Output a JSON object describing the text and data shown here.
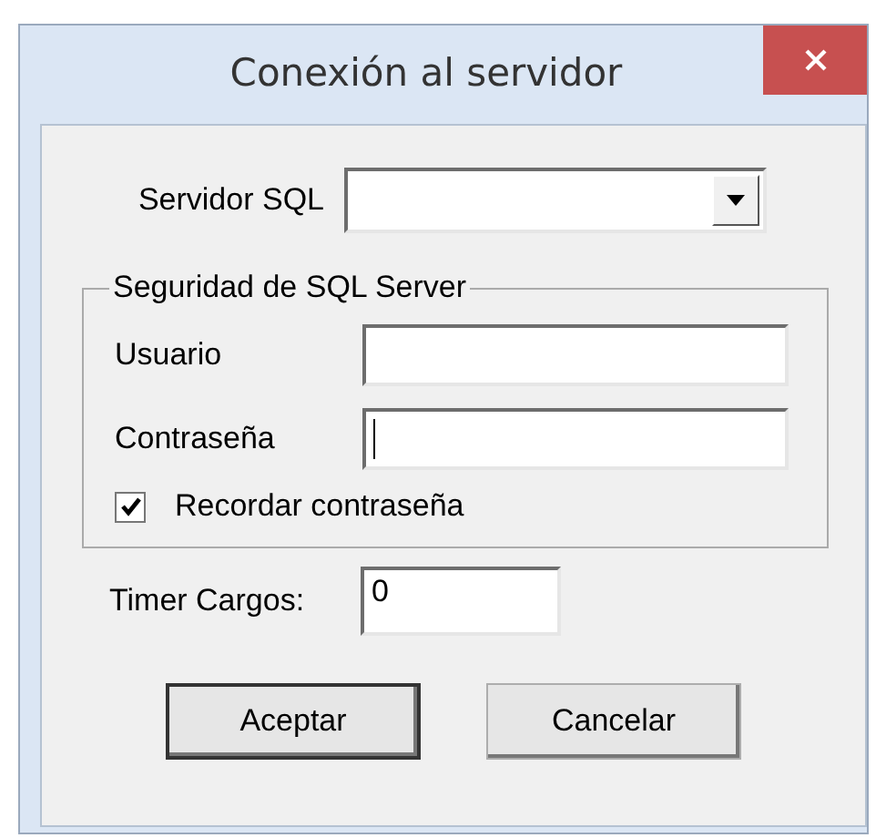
{
  "window": {
    "title": "Conexión al servidor"
  },
  "server": {
    "label": "Servidor SQL"
  },
  "security_group": {
    "title": "Seguridad de SQL Server",
    "fields": [
      {
        "label": "Usuario",
        "focused": false
      },
      {
        "label": "Contraseña",
        "focused": true
      }
    ],
    "remember": {
      "label": "Recordar contraseña",
      "checked": true
    }
  },
  "timer": {
    "label": "Timer Cargos:",
    "value": "0"
  },
  "buttons": [
    {
      "label": "Aceptar",
      "default": true
    },
    {
      "label": "Cancelar",
      "default": false
    }
  ]
}
